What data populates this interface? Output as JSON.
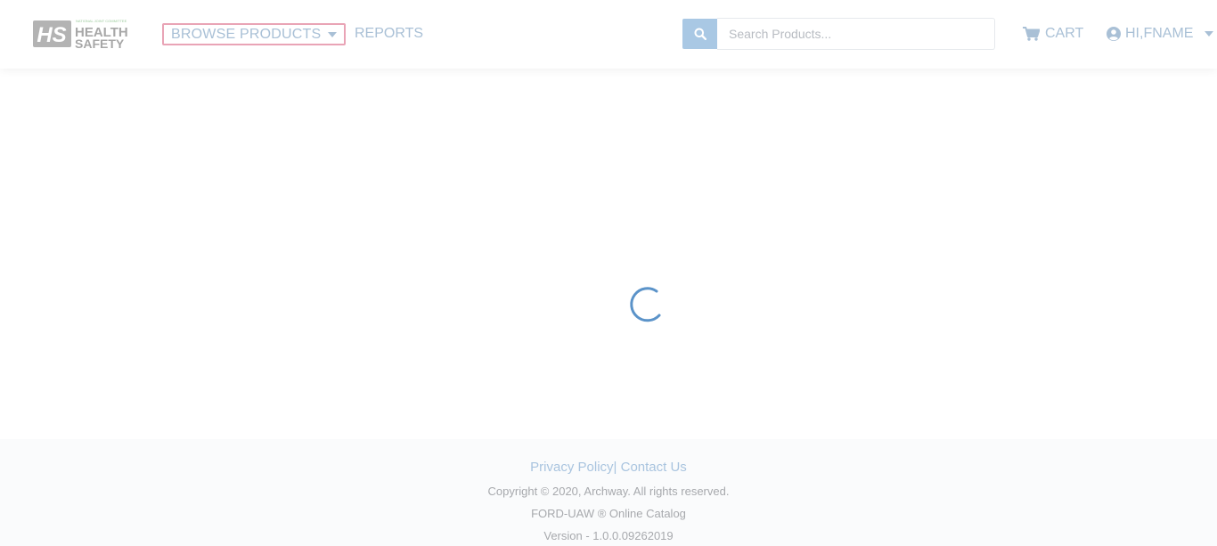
{
  "header": {
    "logo": {
      "mark": "HS",
      "tagline": "NATIONAL JOINT COMMITTEE",
      "line1": "HEALTH",
      "line2": "SAFETY"
    },
    "browse_label": "BROWSE PRODUCTS",
    "reports_label": "REPORTS",
    "search": {
      "placeholder": "Search Products..."
    },
    "cart_label": "CART",
    "user_label": "HI,FNAME"
  },
  "main": {
    "loading": true
  },
  "footer": {
    "privacy_label": "Privacy Policy",
    "separator": "|",
    "contact_label": "Contact Us",
    "copyright": "Copyright © 2020, Archway. All rights reserved.",
    "catalog": "FORD-UAW ® Online Catalog",
    "version": "Version - 1.0.0.09262019"
  },
  "colors": {
    "accent": "#4aa3df",
    "link": "#a9c0d6",
    "focus_border": "#e9a4b6",
    "search_button": "#a9c8e4",
    "spinner": "#5b93c9"
  }
}
